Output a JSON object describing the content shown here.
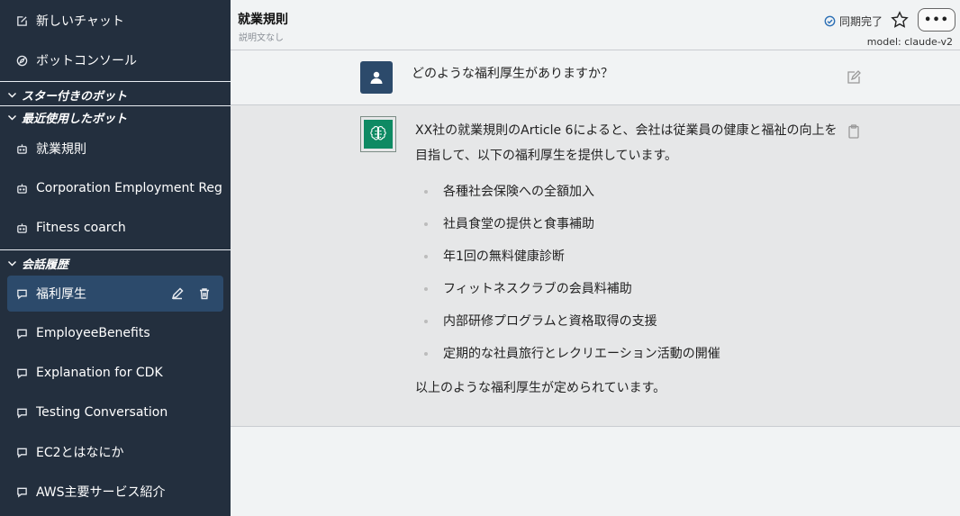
{
  "sidebar": {
    "new_chat": "新しいチャット",
    "bot_console": "ボットコンソール",
    "starred_section": "スター付きのボット",
    "recent_section": "最近使用したボット",
    "recent_bots": [
      "就業規則",
      "Corporation Employment Regulations",
      "Fitness coarch"
    ],
    "history_section": "会話履歴",
    "conversations": [
      "福利厚生",
      "EmployeeBenefits",
      "Explanation for CDK",
      "Testing Conversation",
      "EC2とはなにか",
      "AWS主要サービス紹介"
    ]
  },
  "header": {
    "bot_title": "就業規則",
    "bot_description": "説明文なし",
    "sync_status": "同期完了",
    "more_label": "•••",
    "model_label": "model: claude-v2"
  },
  "messages": {
    "user_question": "どのような福利厚生がありますか？",
    "bot_intro": "XX社の就業規則のArticle 6によると、会社は従業員の健康と福祉の向上を目指して、以下の福利厚生を提供しています。",
    "bot_list": [
      "各種社会保険への全額加入",
      "社員食堂の提供と食事補助",
      "年1回の無料健康診断",
      "フィットネスクラブの会員料補助",
      "内部研修プログラムと資格取得の支援",
      "定期的な社員旅行とレクリエーション活動の開催"
    ],
    "bot_outro": "以上のような福利厚生が定められています。"
  },
  "colors": {
    "sidebar_bg": "#232f3e",
    "active_item": "#2c4a6b",
    "bot_avatar": "#0e8a63"
  }
}
